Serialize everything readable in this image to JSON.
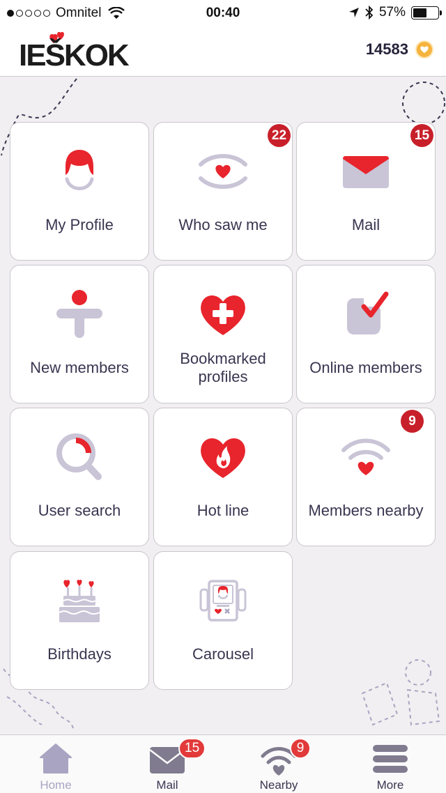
{
  "status_bar": {
    "carrier": "Omnitel",
    "time": "00:40",
    "battery": "57%",
    "battery_level": 0.57
  },
  "header": {
    "logo": "IEŠKOK",
    "coins": "14583"
  },
  "tiles": [
    {
      "label": "My Profile",
      "icon": "profile-icon",
      "badge": ""
    },
    {
      "label": "Who saw me",
      "icon": "eye-heart-icon",
      "badge": "22"
    },
    {
      "label": "Mail",
      "icon": "envelope-icon",
      "badge": "15"
    },
    {
      "label": "New members",
      "icon": "new-member-icon",
      "badge": ""
    },
    {
      "label": "Bookmarked profiles",
      "icon": "heart-plus-icon",
      "badge": ""
    },
    {
      "label": "Online members",
      "icon": "online-check-icon",
      "badge": ""
    },
    {
      "label": "User search",
      "icon": "magnifier-icon",
      "badge": ""
    },
    {
      "label": "Hot line",
      "icon": "heart-flame-icon",
      "badge": ""
    },
    {
      "label": "Members nearby",
      "icon": "wifi-heart-icon",
      "badge": "9"
    },
    {
      "label": "Birthdays",
      "icon": "cake-icon",
      "badge": ""
    },
    {
      "label": "Carousel",
      "icon": "carousel-icon",
      "badge": ""
    }
  ],
  "tabbar": {
    "items": [
      {
        "label": "Home",
        "icon": "home-icon",
        "badge": "",
        "active": true
      },
      {
        "label": "Mail",
        "icon": "mail-icon",
        "badge": "15",
        "active": false
      },
      {
        "label": "Nearby",
        "icon": "nearby-icon",
        "badge": "9",
        "active": false
      },
      {
        "label": "More",
        "icon": "menu-icon",
        "badge": "",
        "active": false
      }
    ]
  },
  "colors": {
    "accent_red": "#e8242c",
    "icon_gray": "#c9c4d6",
    "badge_red": "#c8202a",
    "label_text": "#3a3550"
  }
}
